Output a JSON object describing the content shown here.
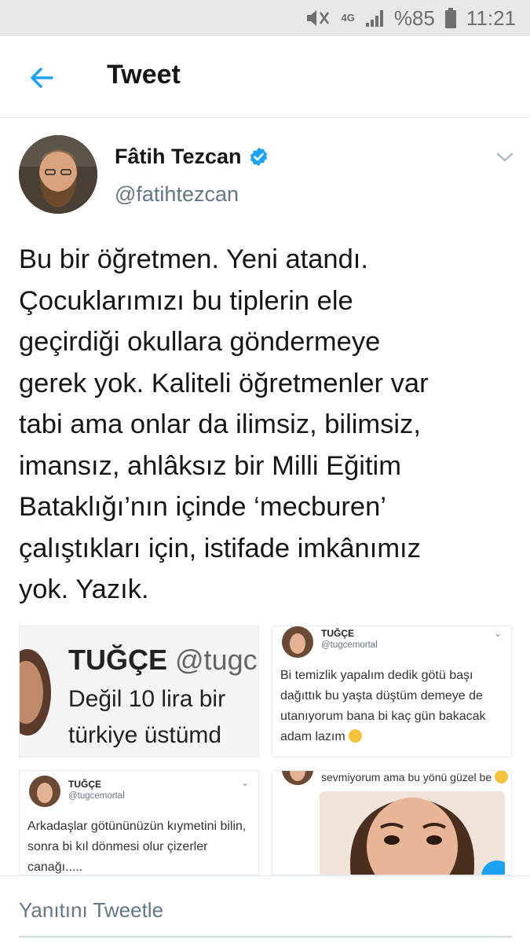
{
  "status_bar": {
    "network": "4G",
    "battery": "%85",
    "time": "11:21"
  },
  "header": {
    "title": "Tweet"
  },
  "author": {
    "name": "Fâtih Tezcan",
    "handle": "@fatihtezcan"
  },
  "tweet": {
    "lines": [
      "Bu bir öğretmen. Yeni atandı.",
      "Çocuklarımızı bu tiplerin ele",
      "geçirdiği okullara göndermeye",
      "gerek yok. Kaliteli öğretmenler var",
      "tabi ama onlar da ilimsiz, bilimsiz,",
      "imansız, ahlâksız bir Milli Eğitim",
      "Bataklığı’nın içinde ‘mecburen’",
      "çalıştıkları için, istifade imkânımız",
      "yok. Yazık."
    ]
  },
  "media": {
    "tile1": {
      "name": "TUĞÇE",
      "handle": "@tugce",
      "line1": "Değil 10 lira bir",
      "line2": "türkiye üstümd"
    },
    "tile2": {
      "name": "TUĞÇE",
      "handle": "@tugcemortal",
      "lines": [
        "Bi temizlik yapalım dedik götü başı",
        "dağıttık bu yaşta düştüm demeye de",
        "utanıyorum bana bi kaç gün bakacak",
        "adam lazım"
      ]
    },
    "tile3": {
      "name": "TUĞÇE",
      "handle": "@tugcemortal",
      "lines": [
        "Arkadaşlar götününüzün kıymetini bilin,",
        "sonra bi kıl dönmesi olur çizerler",
        "canağı....."
      ]
    },
    "tile4": {
      "line": "sevmiyorum ama bu yönü güzel be"
    }
  },
  "reply": {
    "placeholder": "Yanıtını Tweetle"
  },
  "colors": {
    "accent": "#1da1f2",
    "secondary_text": "#657786",
    "status_bar_bg": "#e8e8e8"
  }
}
